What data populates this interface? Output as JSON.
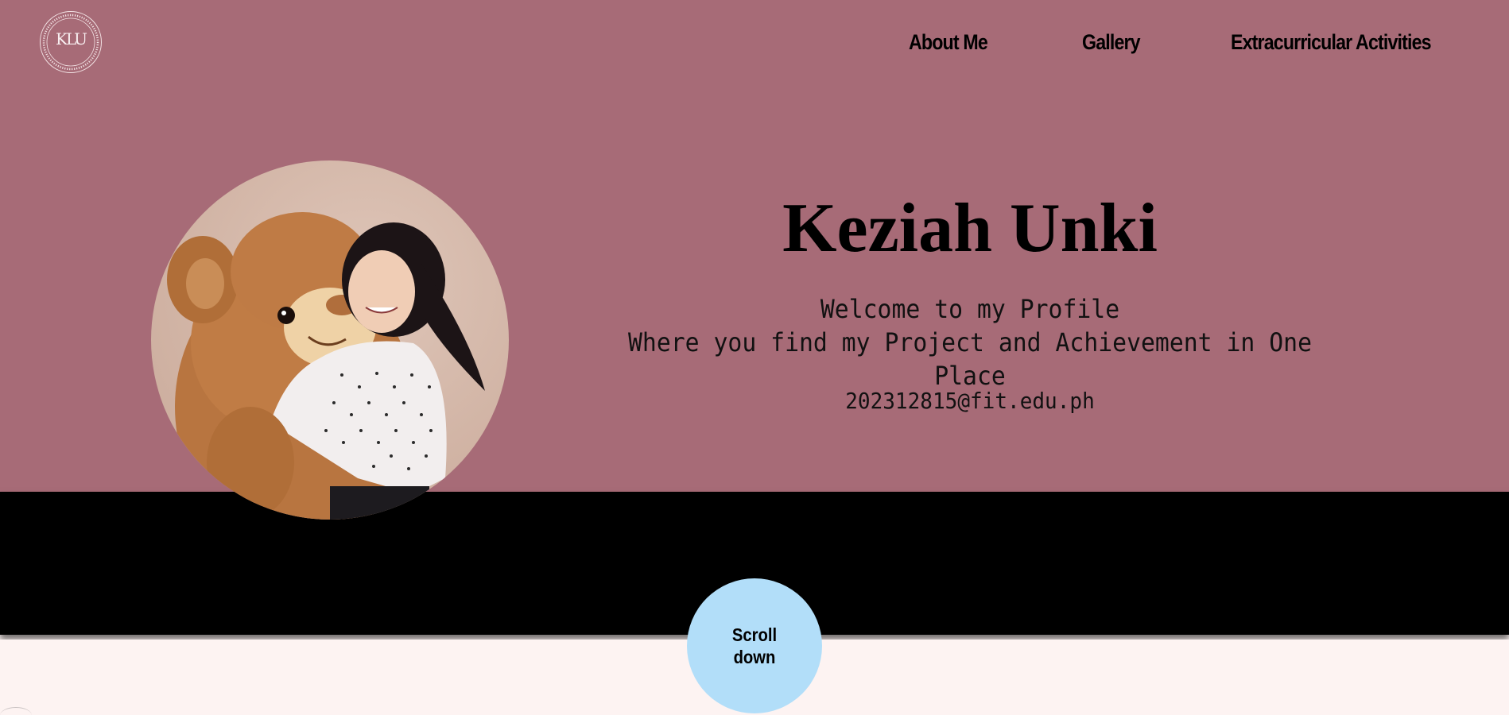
{
  "header": {
    "logo_monogram": "KLU",
    "logo_ring_text": "KEZIAH LEANNE UNKI",
    "nav": [
      {
        "label": "About Me"
      },
      {
        "label": "Gallery"
      },
      {
        "label": "Extracurricular Activities"
      }
    ]
  },
  "hero": {
    "name": "Keziah Unki",
    "welcome_line1": "Welcome to my Profile",
    "welcome_line2": "Where you find my Project and Achievement in One Place",
    "email": "202312815@fit.edu.ph"
  },
  "scroll": {
    "label": "Scroll down"
  },
  "colors": {
    "hero_bg": "#a76b77",
    "band_bg": "#000000",
    "page_bg": "#fdf3f2",
    "scroll_button": "#b2def9"
  }
}
